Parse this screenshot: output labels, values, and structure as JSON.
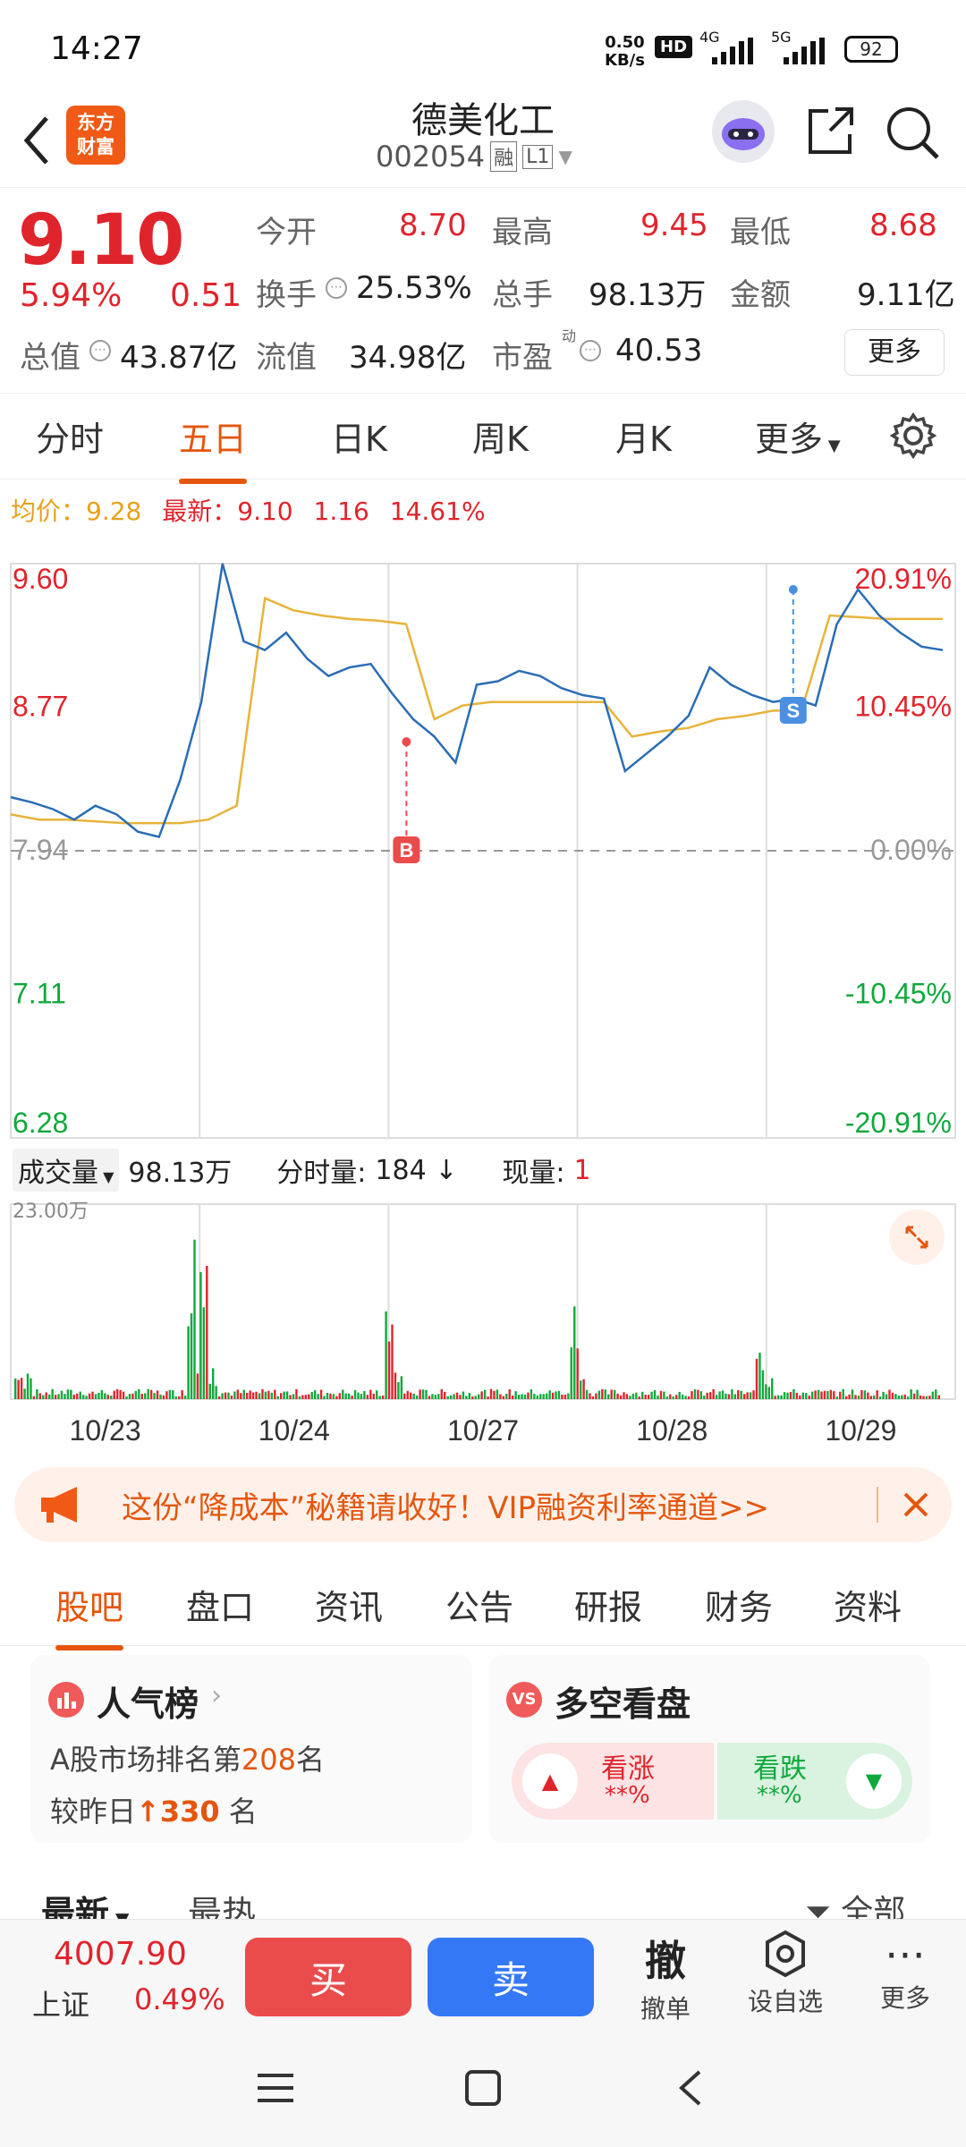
{
  "status_bar": {
    "time": "14:27",
    "speed_value": "0.50",
    "speed_unit": "KB/s",
    "hd": "HD",
    "net1": "4G",
    "net2": "5G",
    "battery": "92"
  },
  "header": {
    "logo_line1": "东方",
    "logo_line2": "财富",
    "title": "德美化工",
    "code": "002054",
    "tag_rong": "融",
    "tag_l1": "L1"
  },
  "quote": {
    "price": "9.10",
    "change_pct": "5.94%",
    "change_amt": "0.51",
    "open_label": "今开",
    "open": "8.70",
    "high_label": "最高",
    "high": "9.45",
    "low_label": "最低",
    "low": "8.68",
    "turnover_label": "换手",
    "turnover": "25.53%",
    "volume_label": "总手",
    "volume": "98.13万",
    "amount_label": "金额",
    "amount": "9.11亿",
    "mktcap_label": "总值",
    "mktcap": "43.87亿",
    "float_label": "流值",
    "float": "34.98亿",
    "pe_label": "市盈",
    "pe_sup": "动",
    "pe": "40.53",
    "more_button": "更多"
  },
  "tabs": [
    "分时",
    "五日",
    "日K",
    "周K",
    "月K",
    "更多"
  ],
  "active_tab": "五日",
  "chart_info": {
    "avg_label": "均价：",
    "avg_value": "9.28",
    "latest_label": "最新：",
    "latest_value": "9.10",
    "latest_change": "1.16",
    "latest_pct": "14.61%"
  },
  "chart_data": {
    "type": "line",
    "days": [
      "10/23",
      "10/24",
      "10/27",
      "10/28",
      "10/29"
    ],
    "prev_close": 7.94,
    "ylim": [
      6.28,
      9.6
    ],
    "y_ticks_left": [
      "9.60",
      "8.77",
      "7.94",
      "7.11",
      "6.28"
    ],
    "y_ticks_right": [
      "20.91%",
      "10.45%",
      "0.00%",
      "-10.45%",
      "-20.91%"
    ],
    "series": [
      {
        "values": [
          8.25,
          8.22,
          8.18,
          8.12,
          8.2,
          8.15,
          8.05,
          8.02,
          8.35,
          8.8,
          9.6,
          9.15,
          9.1,
          9.2,
          9.05,
          8.95,
          9.0,
          9.02,
          8.85,
          8.7,
          8.6,
          8.45,
          8.9,
          8.92,
          8.98,
          8.95,
          8.88,
          8.84,
          8.82,
          8.4,
          8.5,
          8.6,
          8.72,
          9.0,
          8.9,
          8.84,
          8.8,
          8.82,
          8.78,
          9.25,
          9.45,
          9.3,
          9.2,
          9.12,
          9.1
        ]
      },
      {
        "values": [
          8.15,
          8.12,
          8.12,
          8.11,
          8.1,
          8.1,
          8.1,
          8.12,
          8.2,
          9.4,
          9.33,
          9.3,
          9.28,
          9.27,
          9.25,
          8.7,
          8.78,
          8.8,
          8.8,
          8.8,
          8.8,
          8.8,
          8.6,
          8.63,
          8.65,
          8.7,
          8.72,
          8.75,
          8.75,
          9.3,
          9.29,
          9.28,
          9.28,
          9.28
        ]
      }
    ],
    "markers": [
      {
        "label": "B",
        "day": "10/27",
        "value": 8.57
      },
      {
        "label": "S",
        "day": "10/29",
        "value": 9.45
      }
    ]
  },
  "volume_info": {
    "label": "成交量",
    "total": "98.13万",
    "minute_label": "分时量:",
    "minute_value": "184",
    "now_label": "现量:",
    "now_value": "1",
    "max_tick": "23.00万"
  },
  "volume_data": {
    "peaks": [
      3,
      23,
      10,
      11,
      4,
      10
    ]
  },
  "banner": {
    "text": "这份“降成本”秘籍请收好！VIP融资利率通道>>"
  },
  "subtabs": [
    "股吧",
    "盘口",
    "资讯",
    "公告",
    "研报",
    "财务",
    "资料"
  ],
  "active_subtab": "股吧",
  "cards": {
    "popularity": {
      "title": "人气榜",
      "line1_pre": "A股市场排名第",
      "rank": "208",
      "line1_post": "名",
      "line2_pre": "较昨日",
      "change": "330",
      "line2_post": "名"
    },
    "sentiment": {
      "title": "多空看盘",
      "up_label": "看涨",
      "up_value": "**%",
      "down_label": "看跌",
      "down_value": "**%"
    }
  },
  "sort": {
    "latest": "最新",
    "hot": "最热",
    "filter": "全部"
  },
  "bottom": {
    "index_value": "4007.90",
    "index_name": "上证",
    "index_pct": "0.49%",
    "buy": "买",
    "sell": "卖",
    "cancel_icon": "撤",
    "cancel_label": "撤单",
    "watch_label": "设自选",
    "more_label": "更多"
  }
}
